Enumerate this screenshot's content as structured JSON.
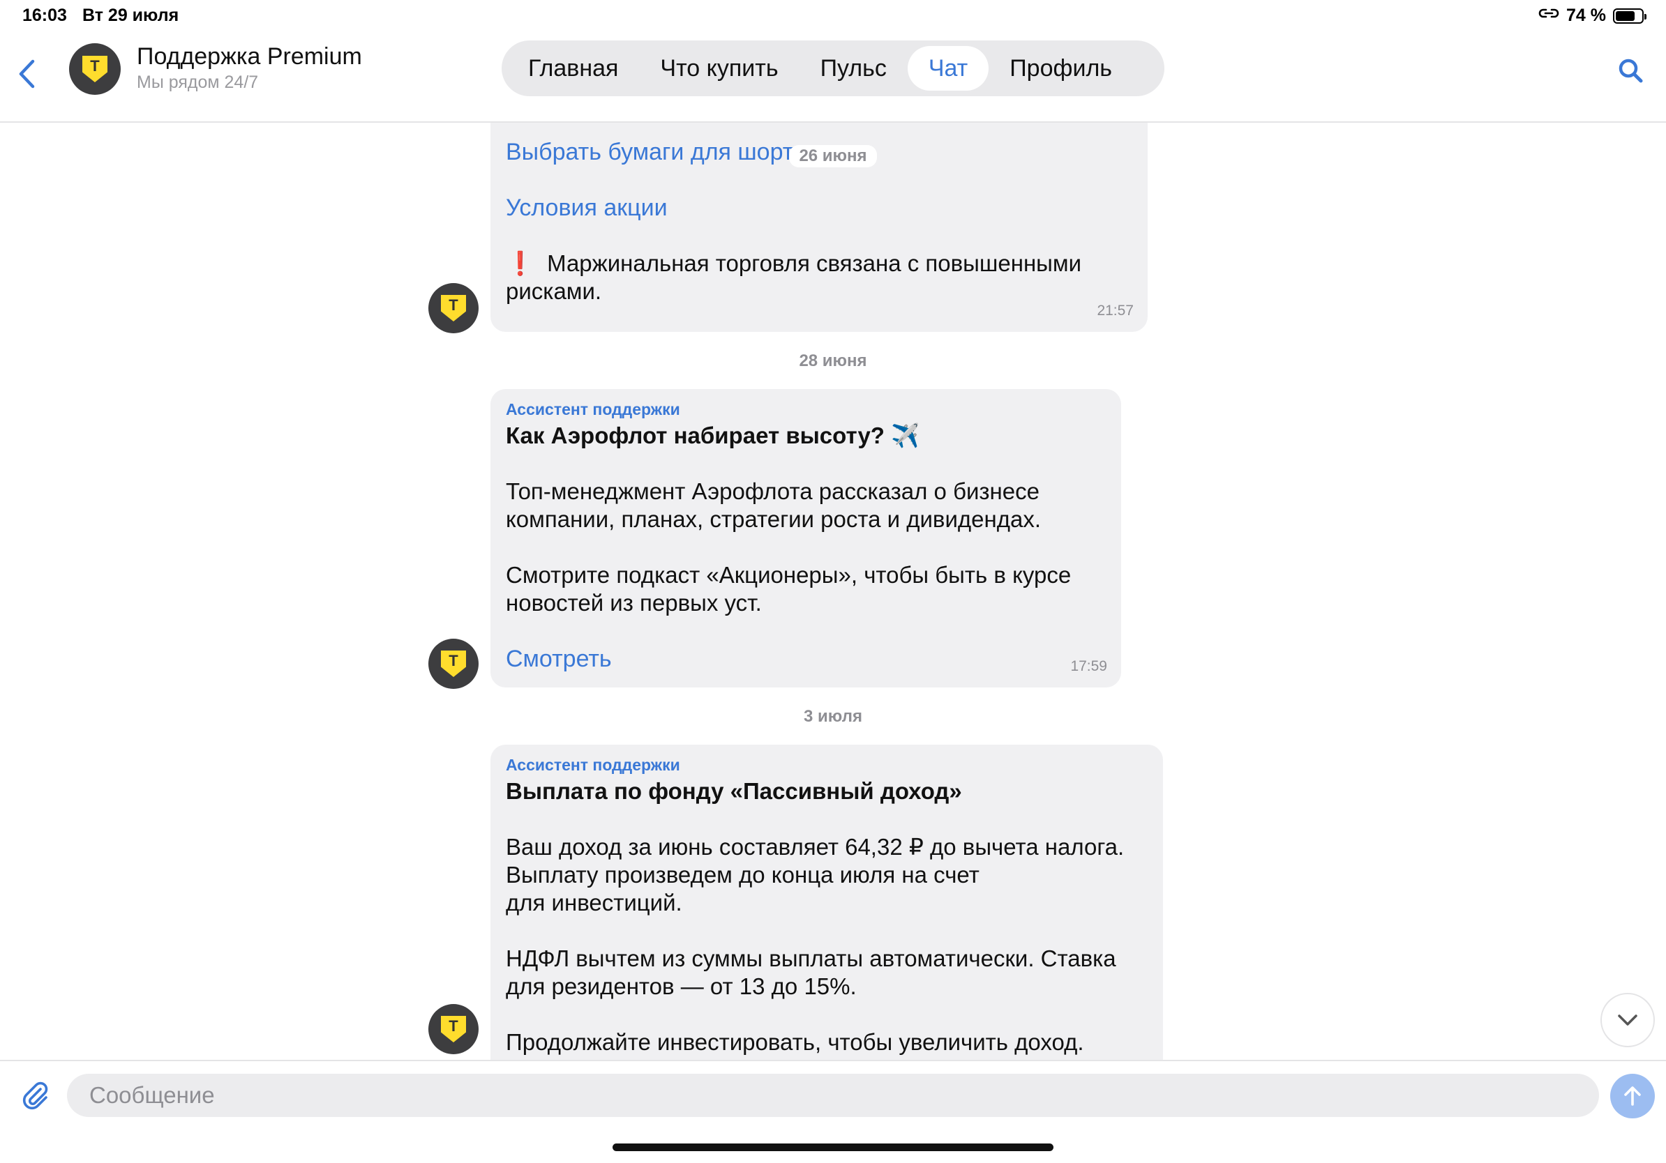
{
  "status_bar": {
    "time": "16:03",
    "date": "Вт 29 июля",
    "battery_text": "74 %",
    "battery_level": 0.74
  },
  "header": {
    "title": "Поддержка Premium",
    "subtitle": "Мы рядом 24/7",
    "avatar_letter": "Т",
    "tabs": [
      {
        "label": "Главная",
        "active": false
      },
      {
        "label": "Что купить",
        "active": false
      },
      {
        "label": "Пульс",
        "active": false
      },
      {
        "label": "Чат",
        "active": true
      },
      {
        "label": "Профиль",
        "active": false
      }
    ]
  },
  "chat": {
    "msg1": {
      "date_overlay": "26 июня",
      "link1": "Выбрать бумаги для шорта",
      "link2": "Условия акции",
      "warning_mark": "❗",
      "warning_text": "Маржинальная торговля связана с повышенными рисками.",
      "time": "21:57"
    },
    "sep1": "28 июня",
    "msg2": {
      "sender": "Ассистент поддержки",
      "title": "Как Аэрофлот набирает высоту? ✈️",
      "p1": "Топ-менеджмент Аэрофлота рассказал о бизнесе компании, планах, стратегии роста и дивидендах.",
      "p2": "Смотрите подкаст «Акционеры», чтобы быть в курсе новостей из первых уст.",
      "link": "Смотреть",
      "time": "17:59"
    },
    "sep2": "3 июля",
    "msg3": {
      "sender": "Ассистент поддержки",
      "title": "Выплата по фонду «Пассивный доход»",
      "p1_line1": "Ваш доход за июнь составляет 64,32 ₽ до вычета налога.",
      "p1_line2": "Выплату произведем до конца июля на счет",
      "p1_line3": "для инвестиций.",
      "p2": "НДФЛ вычтем из суммы выплаты автоматически. Ставка для резидентов — от 13 до 15%.",
      "p3": "Продолжайте инвестировать, чтобы увеличить доход."
    }
  },
  "composer": {
    "placeholder": "Сообщение"
  },
  "colors": {
    "accent": "#3a78d6",
    "bubble": "#f0f0f2",
    "brand_yellow": "#ffdd2d",
    "warning": "#d8203a"
  }
}
